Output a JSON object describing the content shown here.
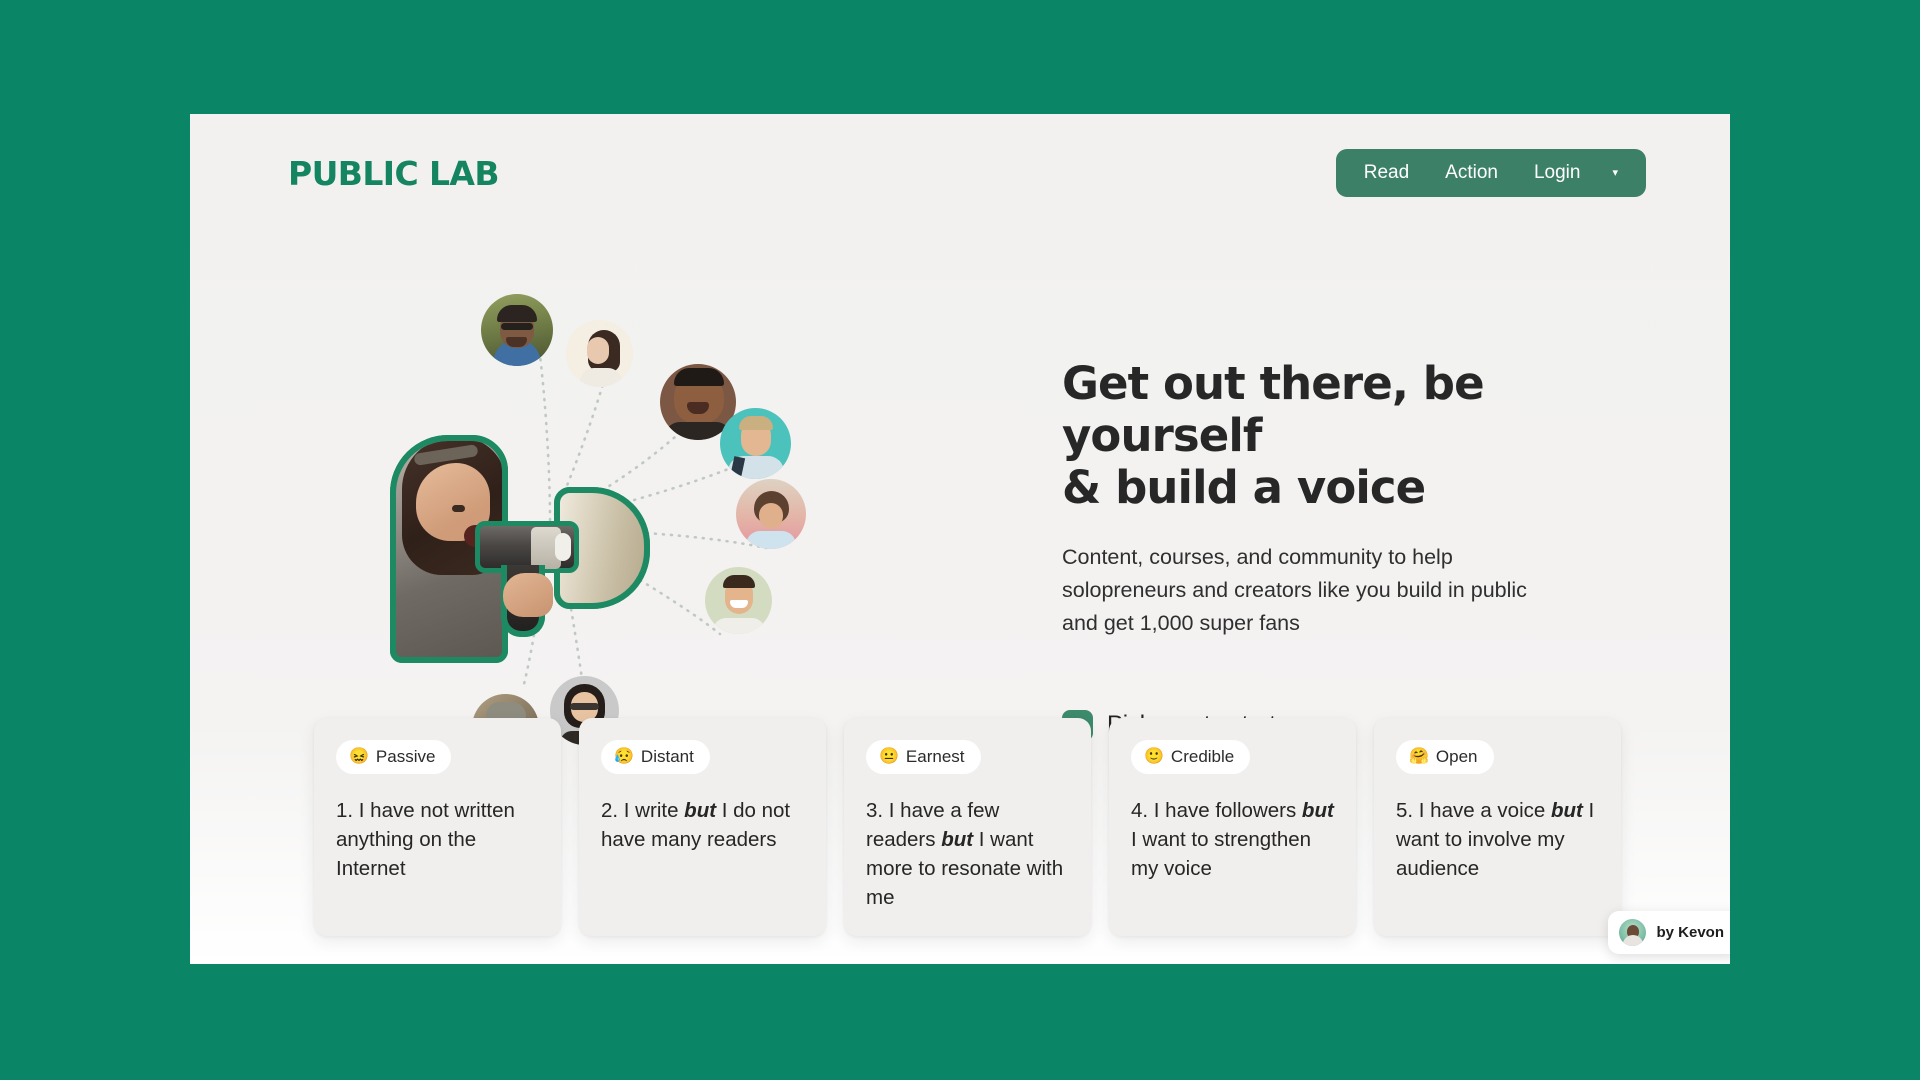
{
  "theme": {
    "page_background": "#0a8566",
    "content_background": "#f2f1ef",
    "brand_green": "#148560",
    "nav_pill_green": "#3c8068",
    "accent_badge_green": "#3d8a6c",
    "outline_green": "#1e8a63",
    "text_dark": "#262626"
  },
  "header": {
    "brand": "PUBLIC LAB",
    "nav": [
      {
        "label": "Read"
      },
      {
        "label": "Action"
      },
      {
        "label": "Login"
      }
    ],
    "nav_caret_icon": "chevron-down-icon",
    "nav_caret_glyph": "▾"
  },
  "hero": {
    "headline": "Get out there, be yourself\n& build a voice",
    "subhead": "Content, courses, and community to help\nsolopreneurs and creators like you build in public\nand get 1,000 super fans",
    "cta": {
      "icon": "arrow-down-icon",
      "icon_glyph": "↓",
      "label": "Pick one to start"
    },
    "illustration": {
      "main_figure": "woman-with-megaphone",
      "avatar_count": 8,
      "avatars": [
        {
          "name": "avatar-smiling-man-glasses",
          "bg": "#7d8a55",
          "skin": "#7d5a41",
          "hair": "#2b2420",
          "shirt": "#3f6fa3"
        },
        {
          "name": "avatar-woman-dark-bob",
          "bg": "#f4ecdf",
          "skin": "#e3c3a8",
          "hair": "#3a2a22",
          "shirt": "#f0ece4"
        },
        {
          "name": "avatar-man-laughing",
          "bg": "#6d4d3c",
          "skin": "#8a5b3d",
          "hair": "#1f1a16",
          "shirt": "#2b2622"
        },
        {
          "name": "avatar-man-teal-background",
          "bg": "#4dc1bd",
          "skin": "#e0b392",
          "hair": "#c9ae7f",
          "shirt": "#cfe0e6"
        },
        {
          "name": "avatar-woman-pink-background",
          "bg": "#e8a0a4",
          "skin": "#dcae8c",
          "hair": "#5c4030",
          "shirt": "#cfe3ef"
        },
        {
          "name": "avatar-man-green-background",
          "bg": "#cfd8bd",
          "skin": "#e2b189",
          "hair": "#3a2a1e",
          "shirt": "#efeee9"
        },
        {
          "name": "avatar-woman-glasses-gray",
          "bg": "#c9c9c9",
          "skin": "#e8c3a2",
          "hair": "#241d19",
          "shirt": "#3a3530"
        },
        {
          "name": "avatar-man-cap",
          "bg": "#9a8b74",
          "skin": "#dcb08a",
          "hair": "#8c8a7d",
          "shirt": "#2c3c63"
        }
      ]
    }
  },
  "cards": [
    {
      "badge_emoji": "😖",
      "badge_emoji_name": "confounded-face-emoji",
      "badge_label": "Passive",
      "text_before": "1. I have not written anything on the Internet",
      "text_bold": "",
      "text_after": ""
    },
    {
      "badge_emoji": "😥",
      "badge_emoji_name": "sad-but-relieved-face-emoji",
      "badge_label": "Distant",
      "text_before": "2. I write ",
      "text_bold": "but",
      "text_after": " I do not have many readers"
    },
    {
      "badge_emoji": "😐",
      "badge_emoji_name": "neutral-face-emoji",
      "badge_label": "Earnest",
      "text_before": "3. I have a few readers ",
      "text_bold": "but",
      "text_after": " I want more to resonate with me"
    },
    {
      "badge_emoji": "🙂",
      "badge_emoji_name": "slightly-smiling-face-emoji",
      "badge_label": "Credible",
      "text_before": "4. I have followers ",
      "text_bold": "but",
      "text_after": " I want to strengthen my voice"
    },
    {
      "badge_emoji": "🤗",
      "badge_emoji_name": "hugging-face-emoji",
      "badge_label": "Open",
      "text_before": "5. I have a voice ",
      "text_bold": "but",
      "text_after": " I want to involve my audience"
    }
  ],
  "attribution": {
    "label": "by Kevon",
    "avatar_name": "kevon-avatar"
  }
}
